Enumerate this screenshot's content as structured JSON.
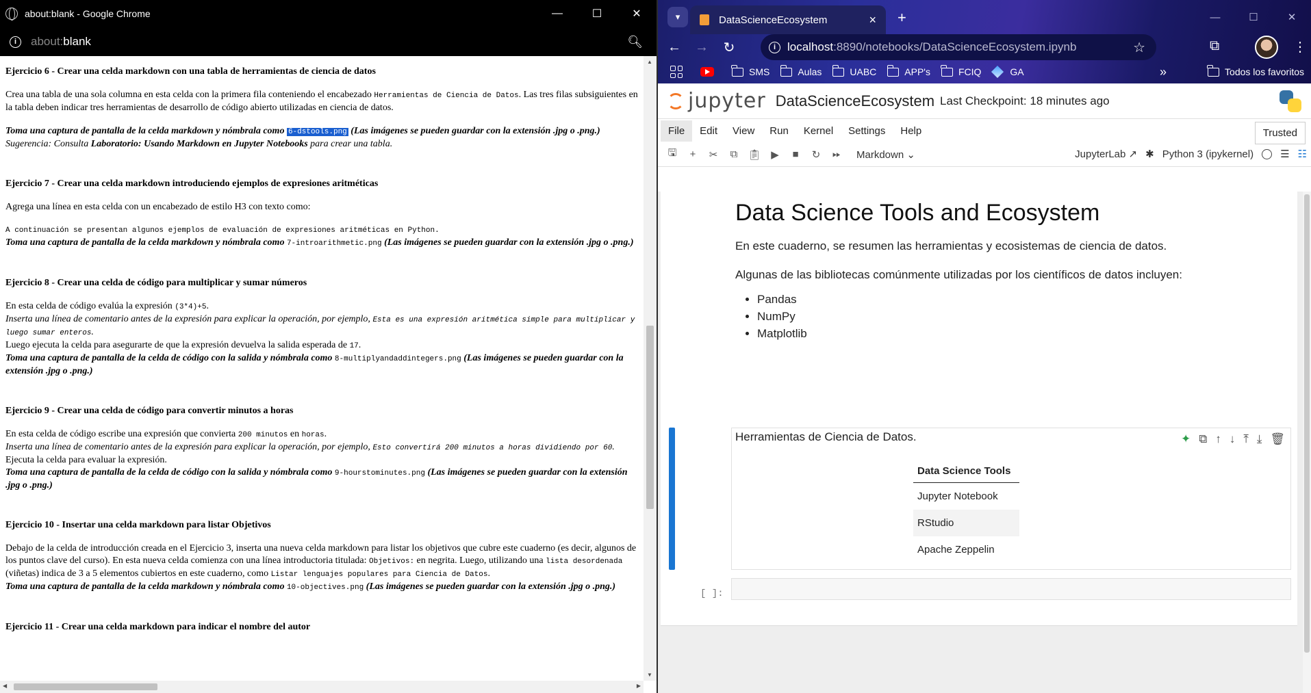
{
  "left_window": {
    "title": "about:blank - Google Chrome",
    "url_gray": "about:",
    "url_main": "blank",
    "controls": {
      "minimize": "—",
      "maximize": "☐",
      "close": "✕"
    },
    "doc": {
      "ex6": {
        "heading": "Ejercicio 6 - Crear una celda markdown con una tabla de herramientas de ciencia de datos",
        "p1_a": "Crea una tabla de una sola columna en esta celda con la primera fila conteniendo el encabezado ",
        "p1_code": "Herramientas de Ciencia de Datos",
        "p1_b": ". Las tres filas subsiguientes en la tabla deben indicar tres herramientas de desarrollo de código abierto utilizadas en ciencia de datos.",
        "shot_a": "Toma una captura de pantalla de la celda markdown y nómbrala como ",
        "shot_file": "6-dstools.png",
        "shot_b": " (Las imágenes se pueden guardar con la extensión .jpg o .png.)",
        "hint_a": "Sugerencia: Consulta ",
        "hint_b": "Laboratorio: Usando Markdown en Jupyter Notebooks",
        "hint_c": " para crear una tabla."
      },
      "ex7": {
        "heading": "Ejercicio 7 - Crear una celda markdown introduciendo ejemplos de expresiones aritméticas",
        "p1": "Agrega una línea en esta celda con un encabezado de estilo H3 con texto como:",
        "code": "A continuación se presentan algunos ejemplos de evaluación de expresiones aritméticas en Python.",
        "shot_a": "Toma una captura de pantalla de la celda markdown y nómbrala como ",
        "shot_file": "7-introarithmetic.png",
        "shot_b": " (Las imágenes se pueden guardar con la extensión .jpg o .png.)"
      },
      "ex8": {
        "heading": "Ejercicio 8 - Crear una celda de código para multiplicar y sumar números",
        "l1_a": "En esta celda de código evalúa la expresión ",
        "l1_code": "(3*4)+5",
        "l1_b": ".",
        "l2_a": "Inserta una línea de comentario antes de la expresión para explicar la operación, por ejemplo, ",
        "l2_code": "Esta es una expresión aritmética simple para multiplicar y luego sumar enteros",
        "l2_b": ".",
        "l3_a": "Luego ejecuta la celda para asegurarte de que la expresión devuelva la salida esperada de ",
        "l3_code": "17",
        "l3_b": ".",
        "shot_a": "Toma una captura de pantalla de la celda de código con la salida y nómbrala como ",
        "shot_file": "8-multiplyandaddintegers.png",
        "shot_b": " (Las imágenes se pueden guardar con la extensión .jpg o .png.)"
      },
      "ex9": {
        "heading": "Ejercicio 9 - Crear una celda de código para convertir minutos a horas",
        "l1_a": "En esta celda de código escribe una expresión que convierta ",
        "l1_code": "200 minutos",
        "l1_b": " en ",
        "l1_code2": "horas",
        "l1_c": ".",
        "l2_a": "Inserta una línea de comentario antes de la expresión para explicar la operación, por ejemplo, ",
        "l2_code": "Esto convertirá 200 minutos a horas dividiendo por 60",
        "l2_b": ".",
        "l3": "Ejecuta la celda para evaluar la expresión.",
        "shot_a": "Toma una captura de pantalla de la celda de código con la salida y nómbrala como ",
        "shot_file": "9-hourstominutes.png",
        "shot_b": " (Las imágenes se pueden guardar con la extensión .jpg o .png.)"
      },
      "ex10": {
        "heading": "Ejercicio 10 - Insertar una celda markdown para listar Objetivos",
        "l1_a": "Debajo de la celda de introducción creada en el Ejercicio 3, inserta una nueva celda markdown para listar los objetivos que cubre este cuaderno (es decir, algunos de los puntos clave del curso). En esta nueva celda comienza con una línea introductoria titulada: ",
        "l1_code": "Objetivos:",
        "l1_b": " en negrita. Luego, utilizando una ",
        "l1_code2": "lista desordenada",
        "l1_c": " (viñetas) indica de 3 a 5 elementos cubiertos en este cuaderno, como ",
        "l1_code3": "Listar lenguajes populares para Ciencia de Datos",
        "l1_d": ".",
        "shot_a": "Toma una captura de pantalla de la celda markdown y nómbrala como ",
        "shot_file": "10-objectives.png",
        "shot_b": " (Las imágenes se pueden guardar con la extensión .jpg o .png.)"
      },
      "ex11": {
        "heading": "Ejercicio 11 - Crear una celda markdown para indicar el nombre del autor"
      }
    }
  },
  "right_window": {
    "tab_title": "DataScienceEcosystem",
    "url_host": "localhost",
    "url_rest": ":8890/notebooks/DataScienceEcosystem.ipynb",
    "bookmarks": [
      "SMS",
      "Aulas",
      "UABC",
      "APP's",
      "FCIQ",
      "GA"
    ],
    "all_bookmarks": "Todos los favoritos",
    "jupyter": {
      "logo_text": "jupyter",
      "notebook_name": "DataScienceEcosystem",
      "checkpoint": "Last Checkpoint: 18 minutes ago",
      "menu": [
        "File",
        "Edit",
        "View",
        "Run",
        "Kernel",
        "Settings",
        "Help"
      ],
      "trusted": "Trusted",
      "cell_type": "Markdown",
      "jupyterlab": "JupyterLab",
      "kernel": "Python 3 (ipykernel)"
    },
    "notebook": {
      "title": "Data Science Tools and Ecosystem",
      "intro": "En este cuaderno, se resumen las herramientas y ecosistemas de ciencia de datos.",
      "libs_intro": "Algunas de las bibliotecas comúnmente utilizadas por los científicos de datos incluyen:",
      "libs": [
        "Pandas",
        "NumPy",
        "Matplotlib"
      ],
      "selected_cell_text": "Herramientas de Ciencia de Datos.",
      "table_header": "Data Science Tools",
      "table_rows": [
        "Jupyter Notebook",
        "RStudio",
        "Apache Zeppelin"
      ],
      "empty_prompt": "[ ]:"
    }
  }
}
